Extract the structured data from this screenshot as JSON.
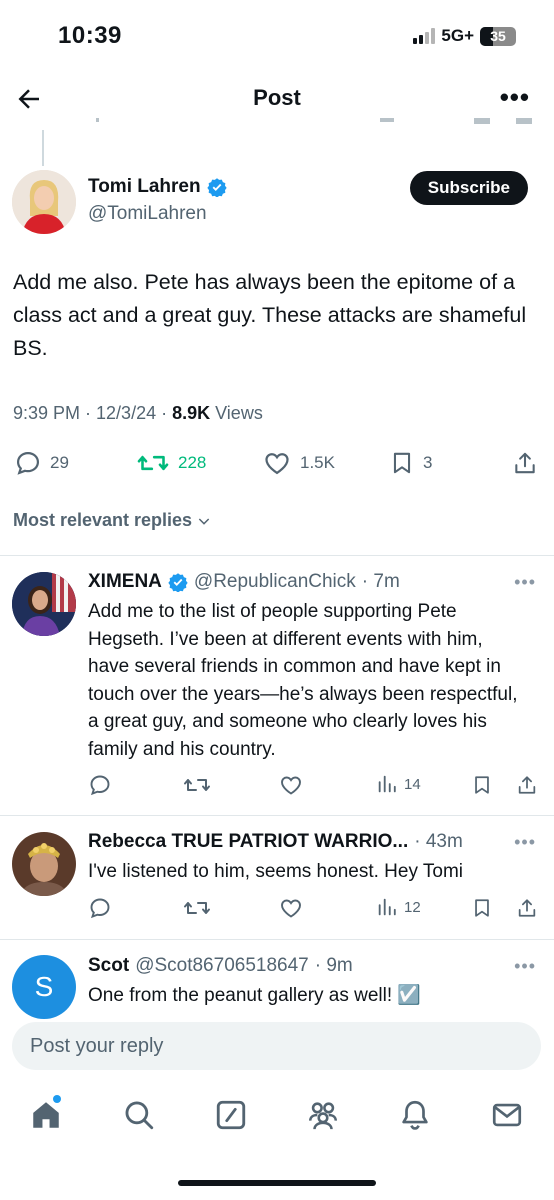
{
  "status_bar": {
    "time": "10:39",
    "network": "5G+",
    "battery": "35"
  },
  "header": {
    "title": "Post"
  },
  "main_post": {
    "name": "Tomi Lahren",
    "handle": "@TomiLahren",
    "subscribe_label": "Subscribe",
    "text": "Add me also. Pete has always been the epitome of a class act and a great guy. These attacks are shameful BS.",
    "time": "9:39 PM · 12/3/24 · ",
    "views_count": "8.9K",
    "views_label": " Views",
    "replies": "29",
    "reposts": "228",
    "likes": "1.5K",
    "bookmarks": "3"
  },
  "sort_label": "Most relevant replies",
  "replies": [
    {
      "name": "XIMENA",
      "handle": "@RepublicanChick",
      "time": "· 7m",
      "text": "Add me to the list of people supporting Pete Hegseth. I’ve been at different events with him, have several friends in common and have kept in touch  over the years—he’s always been respectful, a great guy, and someone who clearly loves his family and his country.",
      "views": "14"
    },
    {
      "name": "Rebecca TRUE PATRIOT WARRIO...",
      "handle": "",
      "time": "· 43m",
      "text": "I've listened to him, seems honest. Hey Tomi",
      "views": "12"
    },
    {
      "name": "Scot",
      "handle": "@Scot86706518647",
      "time": "· 9m",
      "text": "One from the peanut gallery as well! ☑️",
      "avatar_letter": "S"
    }
  ],
  "reply_placeholder": "Post your reply",
  "colors": {
    "accent": "#1d9bf0",
    "repost_green": "#00ba7c",
    "text": "#0f1419",
    "secondary": "#536471"
  },
  "nav_icons": [
    "home-icon",
    "search-icon",
    "grok-icon",
    "communities-icon",
    "notifications-icon",
    "messages-icon"
  ]
}
